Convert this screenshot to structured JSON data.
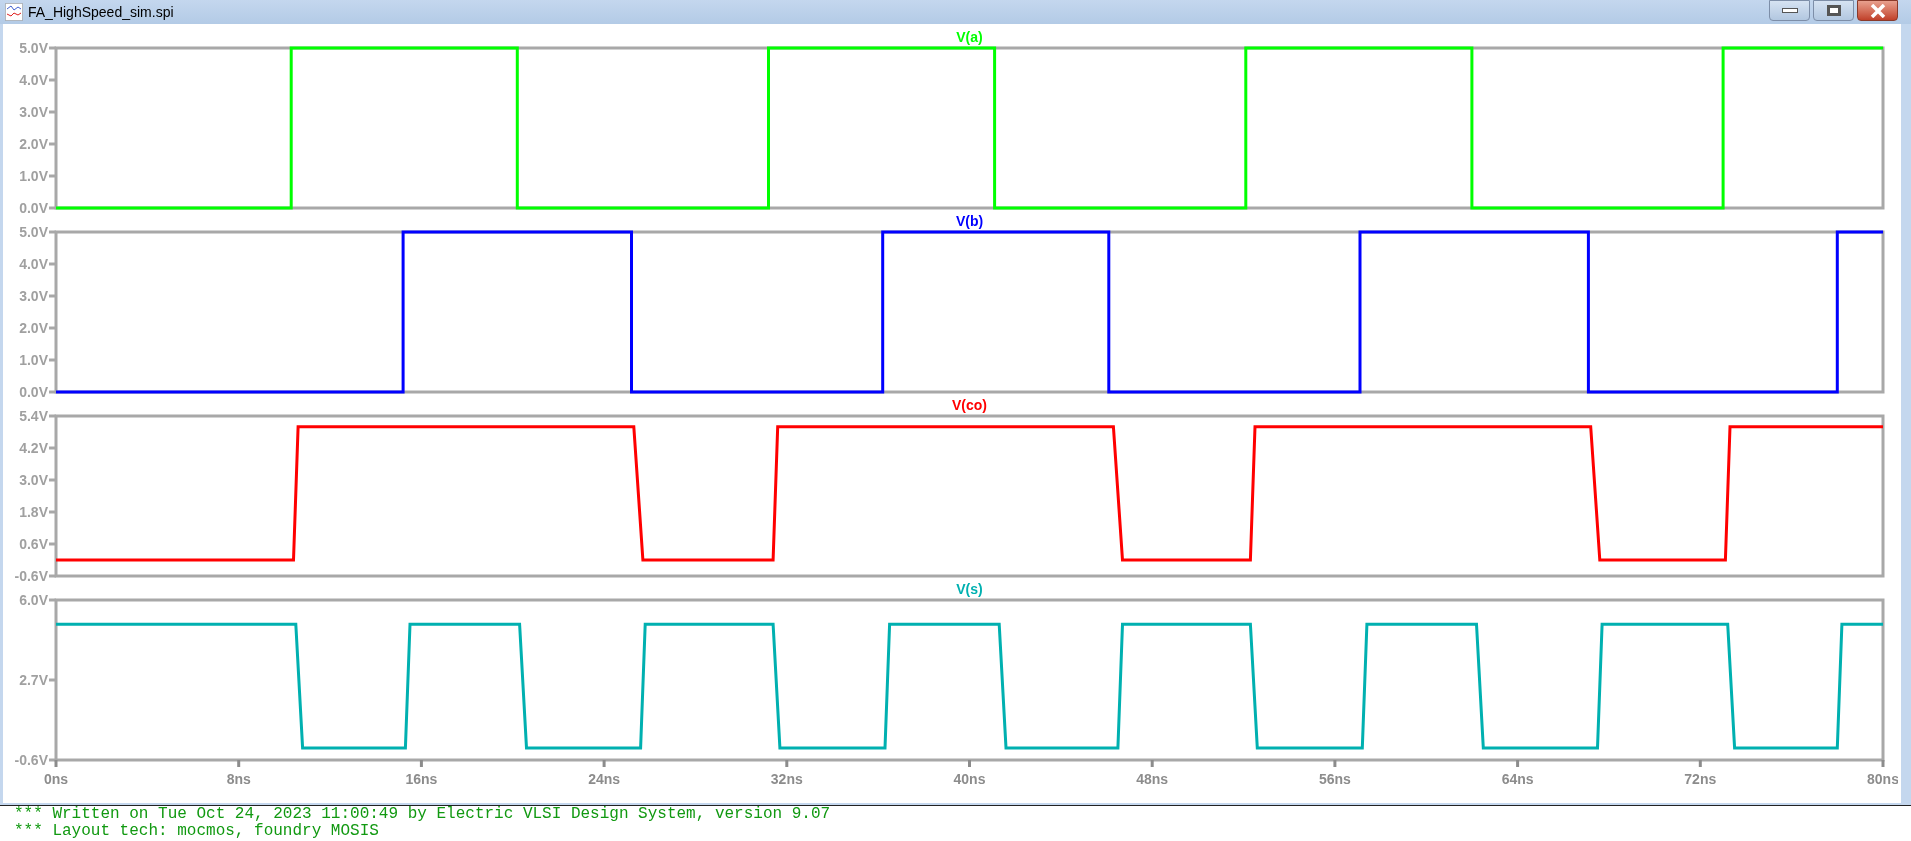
{
  "window": {
    "title": "FA_HighSpeed_sim.spi"
  },
  "charts": [
    {
      "chart_data": {
        "type": "line",
        "x": [
          0,
          10.3,
          10.3,
          20.2,
          20.2,
          31.2,
          31.2,
          41.1,
          41.1,
          52.1,
          52.1,
          62.0,
          62.0,
          73.0,
          73.0,
          80
        ],
        "series": [
          {
            "name": "V(a)",
            "color": "#00ff00",
            "values": [
              0,
              0,
              5,
              5,
              0,
              0,
              5,
              5,
              0,
              0,
              5,
              5,
              0,
              0,
              5,
              5
            ]
          }
        ],
        "xlim": [
          0,
          80
        ],
        "ylim": [
          0,
          5
        ],
        "yticks": [
          {
            "value": 5,
            "label": "5.0V"
          },
          {
            "value": 4,
            "label": "4.0V"
          },
          {
            "value": 3,
            "label": "3.0V"
          },
          {
            "value": 2,
            "label": "2.0V"
          },
          {
            "value": 1,
            "label": "1.0V"
          },
          {
            "value": 0,
            "label": "0.0V"
          }
        ]
      }
    },
    {
      "chart_data": {
        "type": "line",
        "x": [
          0,
          15.2,
          15.2,
          25.2,
          25.2,
          36.2,
          36.2,
          46.1,
          46.1,
          57.1,
          57.1,
          67.1,
          67.1,
          78.0,
          78.0,
          80
        ],
        "series": [
          {
            "name": "V(b)",
            "color": "#0000ff",
            "values": [
              0,
              0,
              5,
              5,
              0,
              0,
              5,
              5,
              0,
              0,
              5,
              5,
              0,
              0,
              5,
              5
            ]
          }
        ],
        "xlim": [
          0,
          80
        ],
        "ylim": [
          0,
          5
        ],
        "yticks": [
          {
            "value": 5,
            "label": "5.0V"
          },
          {
            "value": 4,
            "label": "4.0V"
          },
          {
            "value": 3,
            "label": "3.0V"
          },
          {
            "value": 2,
            "label": "2.0V"
          },
          {
            "value": 1,
            "label": "1.0V"
          },
          {
            "value": 0,
            "label": "0.0V"
          }
        ]
      }
    },
    {
      "chart_data": {
        "type": "line",
        "x": [
          0,
          10.4,
          10.6,
          25.3,
          25.7,
          31.4,
          31.6,
          46.3,
          46.7,
          52.3,
          52.5,
          67.2,
          67.6,
          73.1,
          73.3,
          80
        ],
        "series": [
          {
            "name": "V(co)",
            "color": "#ff0000",
            "values": [
              0,
              0,
              5,
              5,
              0,
              0,
              5,
              5,
              0,
              0,
              5,
              5,
              0,
              0,
              5,
              5
            ]
          }
        ],
        "xlim": [
          0,
          80
        ],
        "ylim": [
          -0.6,
          5.4
        ],
        "yticks": [
          {
            "value": 5.4,
            "label": "5.4V"
          },
          {
            "value": 4.2,
            "label": "4.2V"
          },
          {
            "value": 3.0,
            "label": "3.0V"
          },
          {
            "value": 1.8,
            "label": "1.8V"
          },
          {
            "value": 0.6,
            "label": "0.6V"
          },
          {
            "value": -0.6,
            "label": "-0.6V"
          }
        ]
      }
    },
    {
      "chart_data": {
        "type": "line",
        "x": [
          0,
          10.5,
          10.8,
          15.3,
          15.5,
          20.3,
          20.6,
          25.6,
          25.8,
          31.4,
          31.7,
          36.3,
          36.5,
          41.3,
          41.6,
          46.5,
          46.7,
          52.3,
          52.6,
          57.2,
          57.4,
          62.2,
          62.5,
          67.5,
          67.7,
          73.2,
          73.5,
          78.0,
          78.2,
          80
        ],
        "series": [
          {
            "name": "V(s)",
            "color": "#00b0b0",
            "values": [
              5,
              5,
              -0.1,
              -0.1,
              5,
              5,
              -0.1,
              -0.1,
              5,
              5,
              -0.1,
              -0.1,
              5,
              5,
              -0.1,
              -0.1,
              5,
              5,
              -0.1,
              -0.1,
              5,
              5,
              -0.1,
              -0.1,
              5,
              5,
              -0.1,
              -0.1,
              5,
              5
            ]
          }
        ],
        "xlim": [
          0,
          80
        ],
        "ylim": [
          -0.6,
          6.0
        ],
        "yticks": [
          {
            "value": 6.0,
            "label": "6.0V"
          },
          {
            "value": 2.7,
            "label": "2.7V"
          },
          {
            "value": -0.6,
            "label": "-0.6V"
          }
        ],
        "xticks": [
          {
            "value": 0,
            "label": "0ns"
          },
          {
            "value": 8,
            "label": "8ns"
          },
          {
            "value": 16,
            "label": "16ns"
          },
          {
            "value": 24,
            "label": "24ns"
          },
          {
            "value": 32,
            "label": "32ns"
          },
          {
            "value": 40,
            "label": "40ns"
          },
          {
            "value": 48,
            "label": "48ns"
          },
          {
            "value": 56,
            "label": "56ns"
          },
          {
            "value": 64,
            "label": "64ns"
          },
          {
            "value": 72,
            "label": "72ns"
          },
          {
            "value": 80,
            "label": "80ns"
          }
        ]
      }
    }
  ],
  "log_lines": [
    "*** Written on Tue Oct 24, 2023 11:00:49 by Electric VLSI Design System, version 9.07",
    "*** Layout tech: mocmos, foundry MOSIS"
  ]
}
